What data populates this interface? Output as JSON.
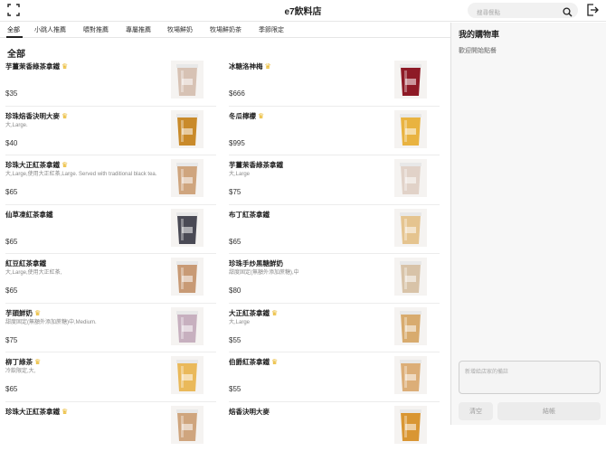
{
  "header": {
    "title": "e7飲料店",
    "search_placeholder": "搜尋餐點"
  },
  "tabs": [
    {
      "label": "全部",
      "active": true
    },
    {
      "label": "小跳人推薦"
    },
    {
      "label": "嚼對推薦"
    },
    {
      "label": "專屬推薦"
    },
    {
      "label": "牧場鮮奶"
    },
    {
      "label": "牧場鮮奶茶"
    },
    {
      "label": "季節限定"
    }
  ],
  "section_title": "全部",
  "products": [
    {
      "name": "芋薑茉香綠茶拿鐵",
      "featured": true,
      "desc": "",
      "price": "$35",
      "drink_color": "#d7c2b4"
    },
    {
      "name": "冰糖洛神梅",
      "featured": true,
      "desc": "",
      "price": "$666",
      "drink_color": "#8e1a26"
    },
    {
      "name": "珍珠焙香決明大麥",
      "featured": true,
      "desc": "大,Large.",
      "price": "$40",
      "drink_color": "#c98a2a"
    },
    {
      "name": "冬瓜檸檬",
      "featured": true,
      "desc": "",
      "price": "$995",
      "drink_color": "#e9b340"
    },
    {
      "name": "珍珠大正紅茶拿鐵",
      "featured": true,
      "desc": "大,Large,使用大正紅茶,Large. Served with traditional black tea.",
      "price": "$65",
      "drink_color": "#cfa57e"
    },
    {
      "name": "芋薑茉香綠茶拿鐵",
      "featured": false,
      "desc": "大,Large",
      "price": "$75",
      "drink_color": "#e1d2c8"
    },
    {
      "name": "仙草凍紅茶拿鐵",
      "featured": false,
      "desc": "",
      "price": "$65",
      "drink_color": "#4a4a55"
    },
    {
      "name": "布丁紅茶拿鐵",
      "featured": false,
      "desc": "",
      "price": "$65",
      "drink_color": "#e5c48f"
    },
    {
      "name": "紅豆紅茶拿鐵",
      "featured": false,
      "desc": "大,Large,使用大正紅茶,",
      "price": "$65",
      "drink_color": "#c89a75"
    },
    {
      "name": "珍珠手炒黑糖鮮奶",
      "featured": false,
      "desc": "甜度固定(無額外添加蔗糖),中",
      "price": "$80",
      "drink_color": "#d8c3a8"
    },
    {
      "name": "芋頭鮮奶",
      "featured": true,
      "desc": "甜度固定(無額外添加蔗糖)中,Medium.",
      "price": "$75",
      "drink_color": "#c7b0bf"
    },
    {
      "name": "大正紅茶拿鐵",
      "featured": true,
      "desc": "大,Large",
      "price": "$55",
      "drink_color": "#d8ab6e"
    },
    {
      "name": "柳丁綠茶",
      "featured": true,
      "desc": "冷飲限定,大,",
      "price": "$65",
      "drink_color": "#eab95a"
    },
    {
      "name": "伯爵紅茶拿鐵",
      "featured": true,
      "desc": "",
      "price": "$55",
      "drink_color": "#dcae78"
    },
    {
      "name": "珍珠大正紅茶拿鐵",
      "featured": true,
      "desc": "",
      "price": "",
      "drink_color": "#cfa57e"
    },
    {
      "name": "焙香決明大麥",
      "featured": false,
      "desc": "",
      "price": "",
      "drink_color": "#d99633"
    }
  ],
  "cart": {
    "title": "我的購物車",
    "empty_text": "歡迎開始點餐",
    "note_placeholder": "新增給店家的備註",
    "clear_label": "清空",
    "checkout_label": "結帳"
  }
}
